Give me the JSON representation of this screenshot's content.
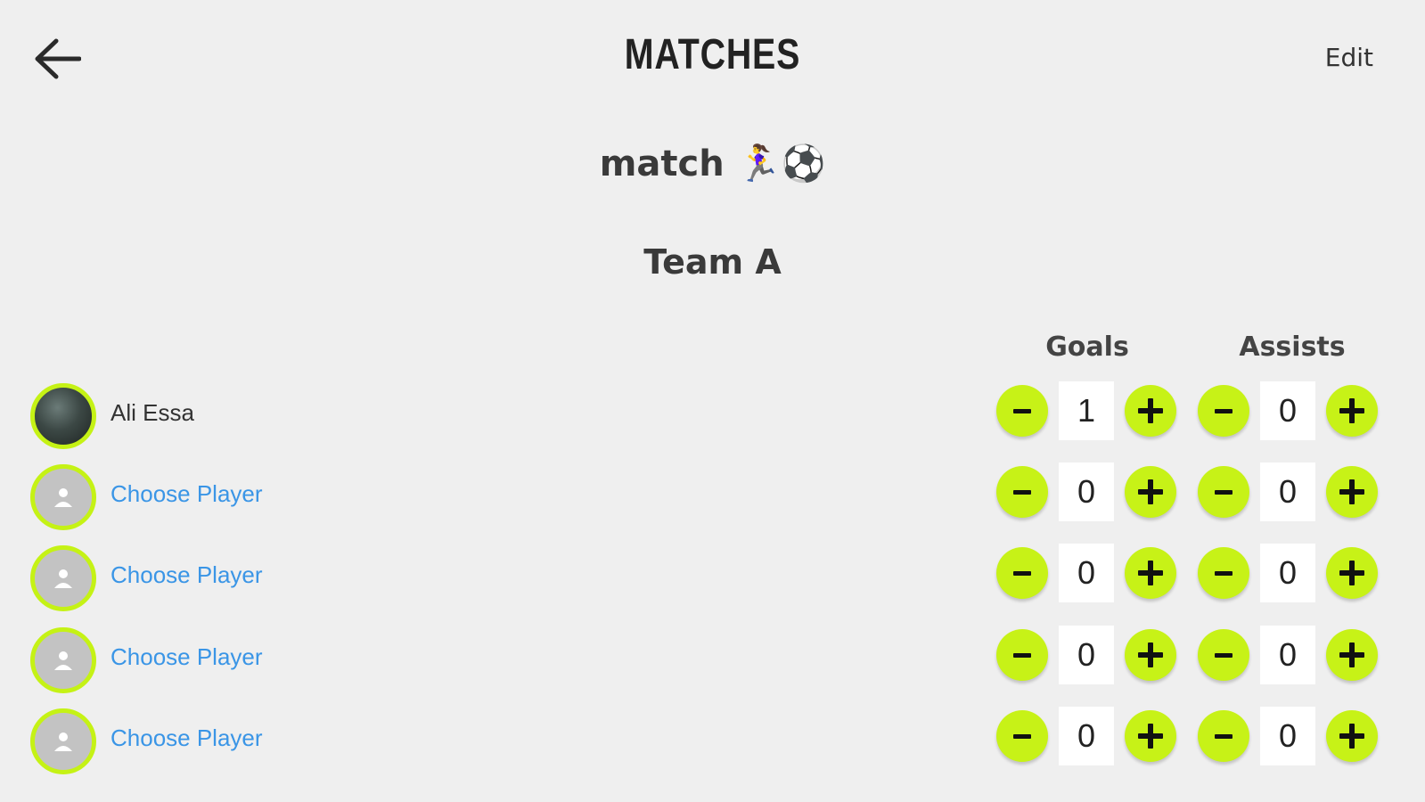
{
  "header": {
    "title": "MATCHES",
    "edit_label": "Edit",
    "back_icon": "arrow-left-icon"
  },
  "match": {
    "name": "match 🏃‍♀️⚽"
  },
  "team": {
    "name": "Team A"
  },
  "columns": {
    "goals": "Goals",
    "assists": "Assists"
  },
  "accent_color": "#c7f217",
  "link_color": "#3a95e6",
  "rows": [
    {
      "name": "Ali Essa",
      "goals": "1",
      "assists": "0",
      "avatar": "photo"
    },
    {
      "name": "Choose Player",
      "goals": "0",
      "assists": "0",
      "avatar": "person-placeholder-icon"
    },
    {
      "name": "Choose Player",
      "goals": "0",
      "assists": "0",
      "avatar": "person-placeholder-icon"
    },
    {
      "name": "Choose Player",
      "goals": "0",
      "assists": "0",
      "avatar": "person-placeholder-icon"
    },
    {
      "name": "Choose Player",
      "goals": "0",
      "assists": "0",
      "avatar": "person-placeholder-icon"
    }
  ]
}
